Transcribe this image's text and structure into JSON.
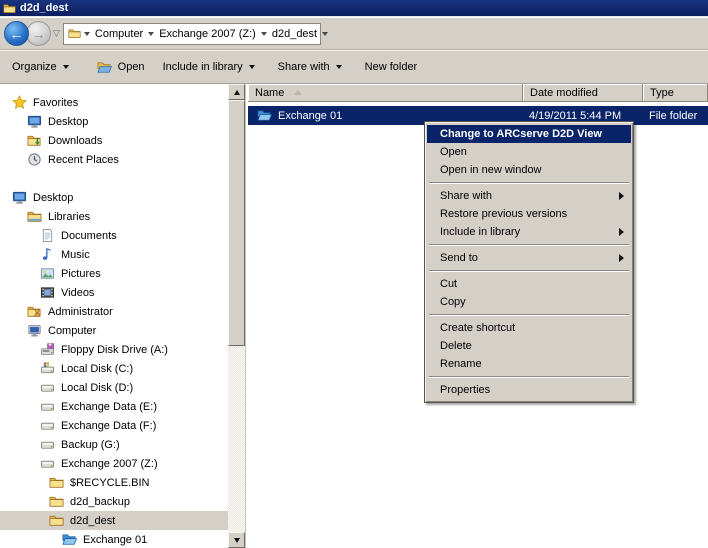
{
  "window": {
    "title": "d2d_dest"
  },
  "colors": {
    "title_bar": "#0d2269",
    "selection": "#0a246a",
    "chrome": "#d4d0c8",
    "menu_highlight": "#0a246a"
  },
  "address": {
    "crumbs": [
      {
        "label": "Computer"
      },
      {
        "label": "Exchange 2007 (Z:)"
      },
      {
        "label": "d2d_dest"
      }
    ]
  },
  "toolbar": {
    "items": [
      {
        "label": "Organize",
        "dropdown": true
      },
      {
        "label": "Open",
        "icon": "open-folder-icon"
      },
      {
        "label": "Include in library",
        "dropdown": true
      },
      {
        "label": "Share with",
        "dropdown": true
      },
      {
        "label": "New folder"
      }
    ]
  },
  "columns": [
    {
      "label": "Name",
      "sorted": "asc"
    },
    {
      "label": "Date modified"
    },
    {
      "label": "Type"
    }
  ],
  "file_list": {
    "rows": [
      {
        "name": "Exchange 01",
        "date_modified": "4/19/2011 5:44 PM",
        "type": "File folder",
        "icon": "open-folder-blue-icon",
        "selected": true
      }
    ]
  },
  "context_menu": {
    "items": [
      {
        "label": "Change to ARCserve D2D View",
        "highlighted": true,
        "default": true
      },
      {
        "label": "Open"
      },
      {
        "label": "Open in new window"
      },
      {
        "separator": true
      },
      {
        "label": "Share with",
        "has_submenu": true
      },
      {
        "label": "Restore previous versions"
      },
      {
        "label": "Include in library",
        "has_submenu": true
      },
      {
        "separator": true
      },
      {
        "label": "Send to",
        "has_submenu": true
      },
      {
        "separator": true
      },
      {
        "label": "Cut"
      },
      {
        "label": "Copy"
      },
      {
        "separator": true
      },
      {
        "label": "Create shortcut"
      },
      {
        "label": "Delete"
      },
      {
        "label": "Rename"
      },
      {
        "separator": true
      },
      {
        "label": "Properties"
      }
    ]
  },
  "sidebar": {
    "items": [
      {
        "label": "Favorites",
        "icon": "star-icon",
        "level": 0
      },
      {
        "label": "Desktop",
        "icon": "monitor-icon",
        "level": 1
      },
      {
        "label": "Downloads",
        "icon": "downloads-icon",
        "level": 1
      },
      {
        "label": "Recent Places",
        "icon": "recent-places-icon",
        "level": 1
      },
      {
        "label": "Desktop",
        "icon": "monitor-icon",
        "level": 0
      },
      {
        "label": "Libraries",
        "icon": "libraries-icon",
        "level": 1
      },
      {
        "label": "Documents",
        "icon": "document-icon",
        "level": 2
      },
      {
        "label": "Music",
        "icon": "music-icon",
        "level": 2
      },
      {
        "label": "Pictures",
        "icon": "pictures-icon",
        "level": 2
      },
      {
        "label": "Videos",
        "icon": "videos-icon",
        "level": 2
      },
      {
        "label": "Administrator",
        "icon": "user-folder-icon",
        "level": 1
      },
      {
        "label": "Computer",
        "icon": "computer-icon",
        "level": 1
      },
      {
        "label": "Floppy Disk Drive (A:)",
        "icon": "floppy-drive-icon",
        "level": 2
      },
      {
        "label": "Local Disk (C:)",
        "icon": "system-drive-icon",
        "level": 2
      },
      {
        "label": "Local Disk (D:)",
        "icon": "drive-icon",
        "level": 2
      },
      {
        "label": "Exchange Data (E:)",
        "icon": "drive-icon",
        "level": 2
      },
      {
        "label": "Exchange Data (F:)",
        "icon": "drive-icon",
        "level": 2
      },
      {
        "label": "Backup (G:)",
        "icon": "drive-icon",
        "level": 2
      },
      {
        "label": "Exchange 2007 (Z:)",
        "icon": "drive-icon",
        "level": 2
      },
      {
        "label": "$RECYCLE.BIN",
        "icon": "folder-icon",
        "level": 3
      },
      {
        "label": "d2d_backup",
        "icon": "folder-icon",
        "level": 3
      },
      {
        "label": "d2d_dest",
        "icon": "folder-icon",
        "level": 3,
        "selected": true
      },
      {
        "label": "Exchange 01",
        "icon": "open-folder-blue-icon",
        "level": 4
      }
    ]
  }
}
